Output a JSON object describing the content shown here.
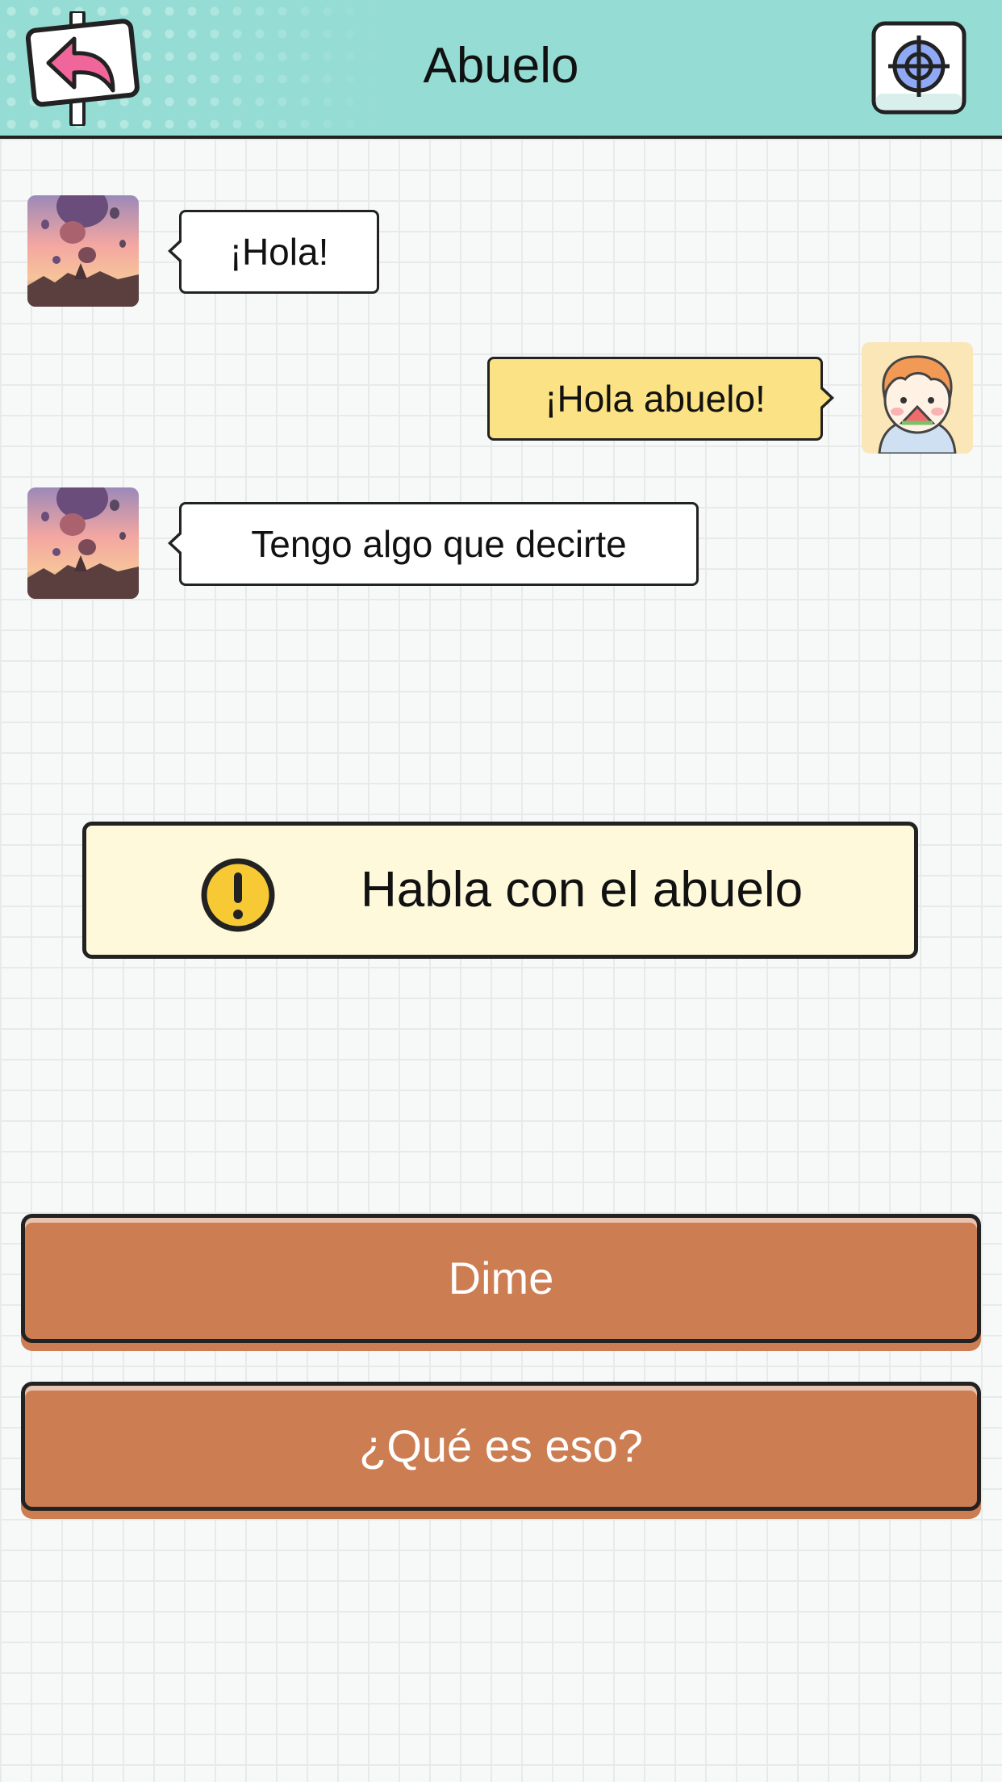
{
  "header": {
    "title": "Abuelo",
    "color": "#95dcd4"
  },
  "chat": {
    "messages": [
      {
        "side": "left",
        "text": "¡Hola!"
      },
      {
        "side": "right",
        "text": "¡Hola abuelo!"
      },
      {
        "side": "left",
        "text": "Tengo algo que decirte"
      }
    ]
  },
  "task": {
    "icon": "exclamation-icon",
    "text": "Habla con el abuelo"
  },
  "options": [
    {
      "label": "Dime"
    },
    {
      "label": "¿Qué es eso?"
    }
  ],
  "colors": {
    "option_button": "#cc7d51",
    "player_bubble": "#fbe385",
    "task_background": "#fdf9da"
  }
}
